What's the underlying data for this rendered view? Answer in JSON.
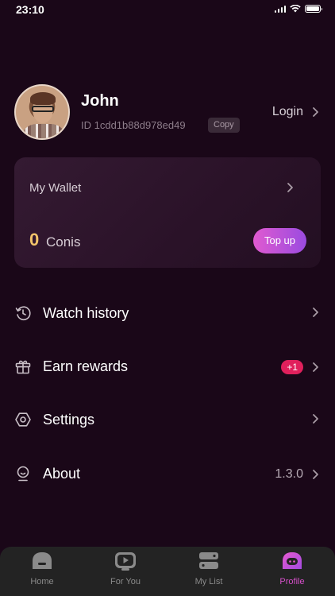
{
  "status_bar": {
    "time": "23:10"
  },
  "profile": {
    "name": "John",
    "id_text": "ID 1cdd1b88d978ed49",
    "copy_label": "Copy",
    "login_label": "Login"
  },
  "wallet": {
    "title": "My Wallet",
    "amount": "0",
    "unit": "Conis",
    "topup_label": "Top up"
  },
  "menu": {
    "items": [
      {
        "label": "Watch history",
        "icon": "history-icon",
        "value": "",
        "badge": ""
      },
      {
        "label": "Earn rewards",
        "icon": "gift-icon",
        "value": "",
        "badge": "+1"
      },
      {
        "label": "Settings",
        "icon": "settings-icon",
        "value": "",
        "badge": ""
      },
      {
        "label": "About",
        "icon": "about-icon",
        "value": "1.3.0",
        "badge": ""
      }
    ]
  },
  "tabbar": {
    "tabs": [
      {
        "label": "Home",
        "icon": "home-icon",
        "active": false
      },
      {
        "label": "For You",
        "icon": "play-icon",
        "active": false
      },
      {
        "label": "My List",
        "icon": "list-icon",
        "active": false
      },
      {
        "label": "Profile",
        "icon": "profile-icon",
        "active": true
      }
    ]
  },
  "colors": {
    "background": "#1a0718",
    "accent": "#d44fc8",
    "coin": "#f1c36a",
    "badge": "#e0205c"
  }
}
